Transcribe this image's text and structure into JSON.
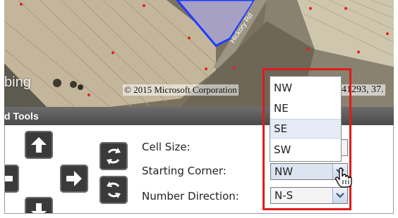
{
  "map": {
    "logo_text": "bing",
    "copyright": "© 2015 Microsoft Corporation",
    "coords_partial": "41293, 37.",
    "road_label": "Hickory Rd"
  },
  "panel": {
    "title": "d Tools"
  },
  "grid_tools": {
    "cell_size_label": "Cell Size:",
    "starting_corner_label": "Starting Corner:",
    "starting_corner_value": "NW",
    "number_direction_label": "Number Direction:",
    "number_direction_value": "N-S"
  },
  "dropdown": {
    "options": [
      "NW",
      "NE",
      "SE",
      "SW"
    ],
    "hovered": "SE"
  },
  "colors": {
    "highlight": "#e01b1b",
    "panel_header": "#555555",
    "field_boundary": "#1f3cff"
  },
  "icons": [
    "arrow-up-icon",
    "arrow-left-icon",
    "arrow-right-icon",
    "arrow-down-icon",
    "rotate-icon",
    "hand-cursor-icon"
  ]
}
